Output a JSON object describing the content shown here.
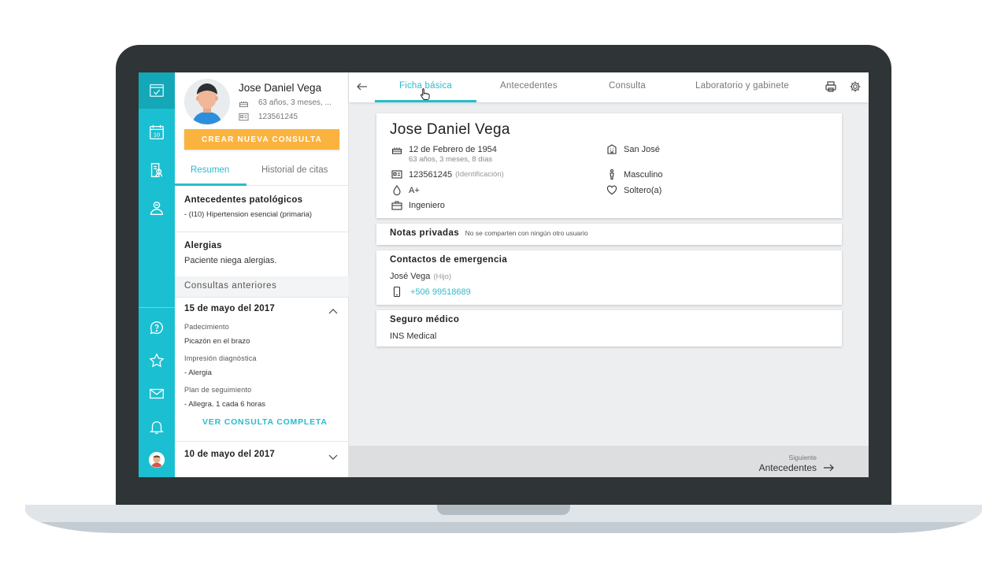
{
  "patient": {
    "name": "Jose Daniel Vega",
    "age_short": "63 años, 3 meses, ...",
    "id_number": "123561245"
  },
  "sidebar": {
    "new_consult_button": "CREAR NUEVA CONSULTA",
    "tabs": [
      "Resumen",
      "Historial de citas"
    ],
    "pathologic": {
      "title": "Antecedentes patológicos",
      "item": "- (I10) Hipertension esencial (primaria)"
    },
    "allergies": {
      "title": "Alergias",
      "text": "Paciente niega alergias."
    },
    "previous_header": "Consultas anteriores",
    "visit1": {
      "date": "15 de mayo del 2017",
      "padecimiento_label": "Padecimiento",
      "padecimiento": "Picazón en el brazo",
      "impresion_label": "Impresión diagnóstica",
      "impresion": "- Alergia",
      "plan_label": "Plan de seguimiento",
      "plan": "- Allegra. 1 cada 6 horas",
      "link": "VER CONSULTA COMPLETA"
    },
    "visit2": {
      "date": "10 de mayo del 2017"
    }
  },
  "main": {
    "tabs": [
      "Ficha básica",
      "Antecedentes",
      "Consulta",
      "Laboratorio y gabinete"
    ],
    "card": {
      "name": "Jose Daniel Vega",
      "birth": "12 de Febrero de 1954",
      "age_full": "63 años, 3 meses, 8 días",
      "id": "123561245",
      "id_label": "(Identificación)",
      "blood": "A+",
      "occupation": "Ingeniero",
      "city": "San José",
      "gender": "Masculino",
      "civil": "Soltero(a)"
    },
    "notes": {
      "title": "Notas privadas",
      "note": "No se comparten con ningún otro usuario"
    },
    "emergency": {
      "title": "Contactos de emergencia",
      "name": "José Vega",
      "relation": "(Hijo)",
      "phone": "+506 99518689"
    },
    "insurance": {
      "title": "Seguro médico",
      "value": "INS Medical"
    },
    "footer": {
      "next_label": "Siguiente",
      "next_value": "Antecedentes"
    }
  },
  "colors": {
    "accent": "#29bccc",
    "rail": "#1bbfd2",
    "button": "#fbb33f",
    "frame": "#2f3436"
  }
}
